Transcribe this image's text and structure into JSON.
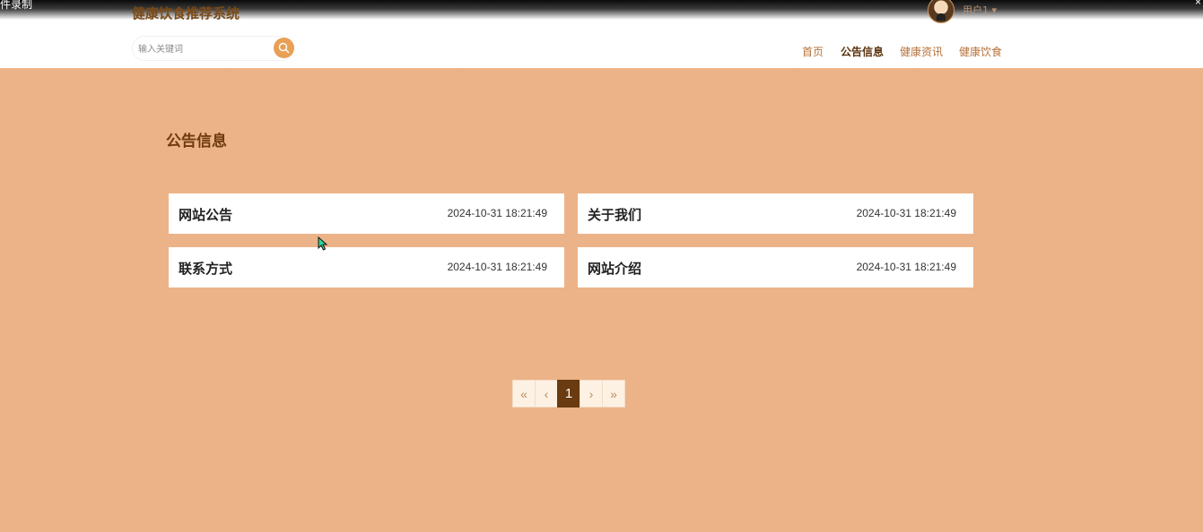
{
  "recorder": {
    "label": "件录制",
    "close": "×"
  },
  "header": {
    "site_title": "健康饮食推荐系统",
    "user_label": "用户1 ▾",
    "search_placeholder": "输入关键词",
    "nav": [
      {
        "label": "首页",
        "active": false
      },
      {
        "label": "公告信息",
        "active": true
      },
      {
        "label": "健康资讯",
        "active": false
      },
      {
        "label": "健康饮食",
        "active": false
      }
    ]
  },
  "main": {
    "section_title": "公告信息",
    "notices": [
      {
        "title": "网站公告",
        "time": "2024-10-31 18:21:49"
      },
      {
        "title": "关于我们",
        "time": "2024-10-31 18:21:49"
      },
      {
        "title": "联系方式",
        "time": "2024-10-31 18:21:49"
      },
      {
        "title": "网站介绍",
        "time": "2024-10-31 18:21:49"
      }
    ]
  },
  "pagination": {
    "first": "«",
    "prev": "‹",
    "current": "1",
    "next": "›",
    "last": "»"
  },
  "colors": {
    "background": "#ecb388",
    "accent": "#e8a056",
    "title": "#6e3a0e",
    "active_page": "#6a3a10"
  }
}
